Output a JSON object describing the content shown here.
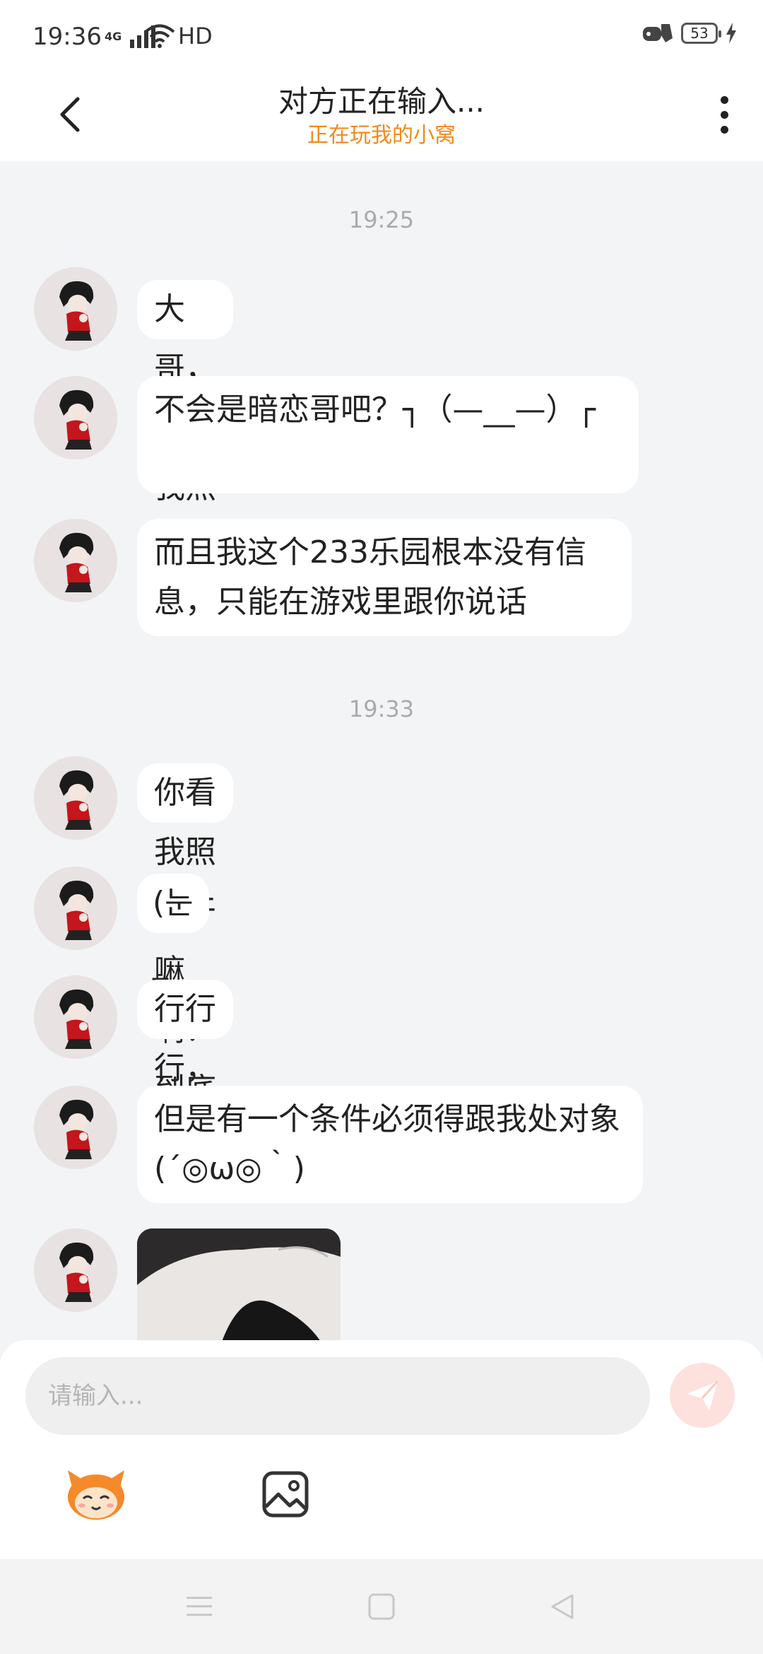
{
  "status_bar": {
    "time": "19:36",
    "network": "4G",
    "hd": "HD",
    "battery": "53"
  },
  "header": {
    "title": "对方正在输入...",
    "subtitle": "正在玩我的小窝"
  },
  "chat": {
    "timestamps": [
      "19:25",
      "19:33"
    ],
    "messages": [
      "大哥，你看我照片干嘛？",
      "不会是暗恋哥吧？┐（—__—）┌",
      "而且我这个233乐园根本没有信息，只能在游戏里跟你说话",
      "你看我照片干嘛啊？到底",
      "(눈_눈)",
      "行行行，给你发",
      "但是有一个条件必须得跟我处对象(´◎ω◎｀)"
    ]
  },
  "input": {
    "placeholder": "请输入..."
  },
  "colors": {
    "accent": "#f28a1c",
    "chat_bg": "#f3f4f6",
    "bubble": "#ffffff",
    "send_button": "#fde1dc"
  },
  "icons": [
    "back-arrow-icon",
    "more-dots-icon",
    "send-icon",
    "emoji-sticker-icon",
    "image-icon",
    "nav-menu-icon",
    "nav-home-icon",
    "nav-back-icon"
  ]
}
